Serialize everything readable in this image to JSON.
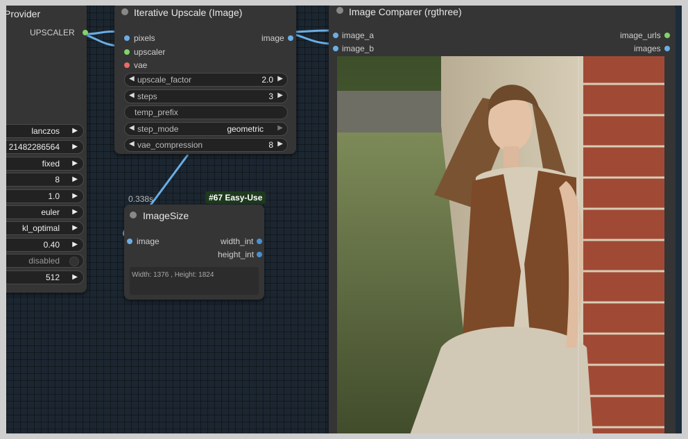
{
  "left_node": {
    "title": "Provider",
    "output_label": "UPSCALER",
    "widgets": [
      {
        "value": "lanczos",
        "type": "arrow"
      },
      {
        "value": "21482286564",
        "type": "arrow"
      },
      {
        "value": "fixed",
        "type": "arrow"
      },
      {
        "value": "8",
        "type": "arrow"
      },
      {
        "value": "1.0",
        "type": "arrow"
      },
      {
        "value": "euler",
        "type": "arrow"
      },
      {
        "value": "kl_optimal",
        "type": "arrow"
      },
      {
        "value": "0.40",
        "type": "arrow"
      },
      {
        "value": "disabled",
        "type": "toggle"
      },
      {
        "value": "512",
        "type": "arrow"
      }
    ]
  },
  "iterative_upscale": {
    "title": "Iterative Upscale (Image)",
    "inputs": [
      "pixels",
      "upscaler",
      "vae"
    ],
    "output": "image",
    "widgets": [
      {
        "label": "upscale_factor",
        "value": "2.0"
      },
      {
        "label": "steps",
        "value": "3"
      },
      {
        "label": "temp_prefix",
        "value": ""
      },
      {
        "label": "step_mode",
        "value": "geometric"
      },
      {
        "label": "vae_compression",
        "value": "8"
      }
    ]
  },
  "image_size": {
    "timing": "0.338s",
    "badge": "#67 Easy-Use",
    "title": "ImageSize",
    "input": "image",
    "outputs": [
      "width_int",
      "height_int"
    ],
    "info": "Width: 1376 , Height: 1824"
  },
  "image_comparer": {
    "title": "Image Comparer (rgthree)",
    "inputs": [
      "image_a",
      "image_b"
    ],
    "outputs": [
      "image_urls",
      "images"
    ]
  },
  "colors": {
    "canvas_bg": "#1c2630",
    "node_bg": "#353535",
    "link_blue": "#6aaee6",
    "slot_green": "#7fd46a",
    "slot_red": "#e86a6a"
  }
}
